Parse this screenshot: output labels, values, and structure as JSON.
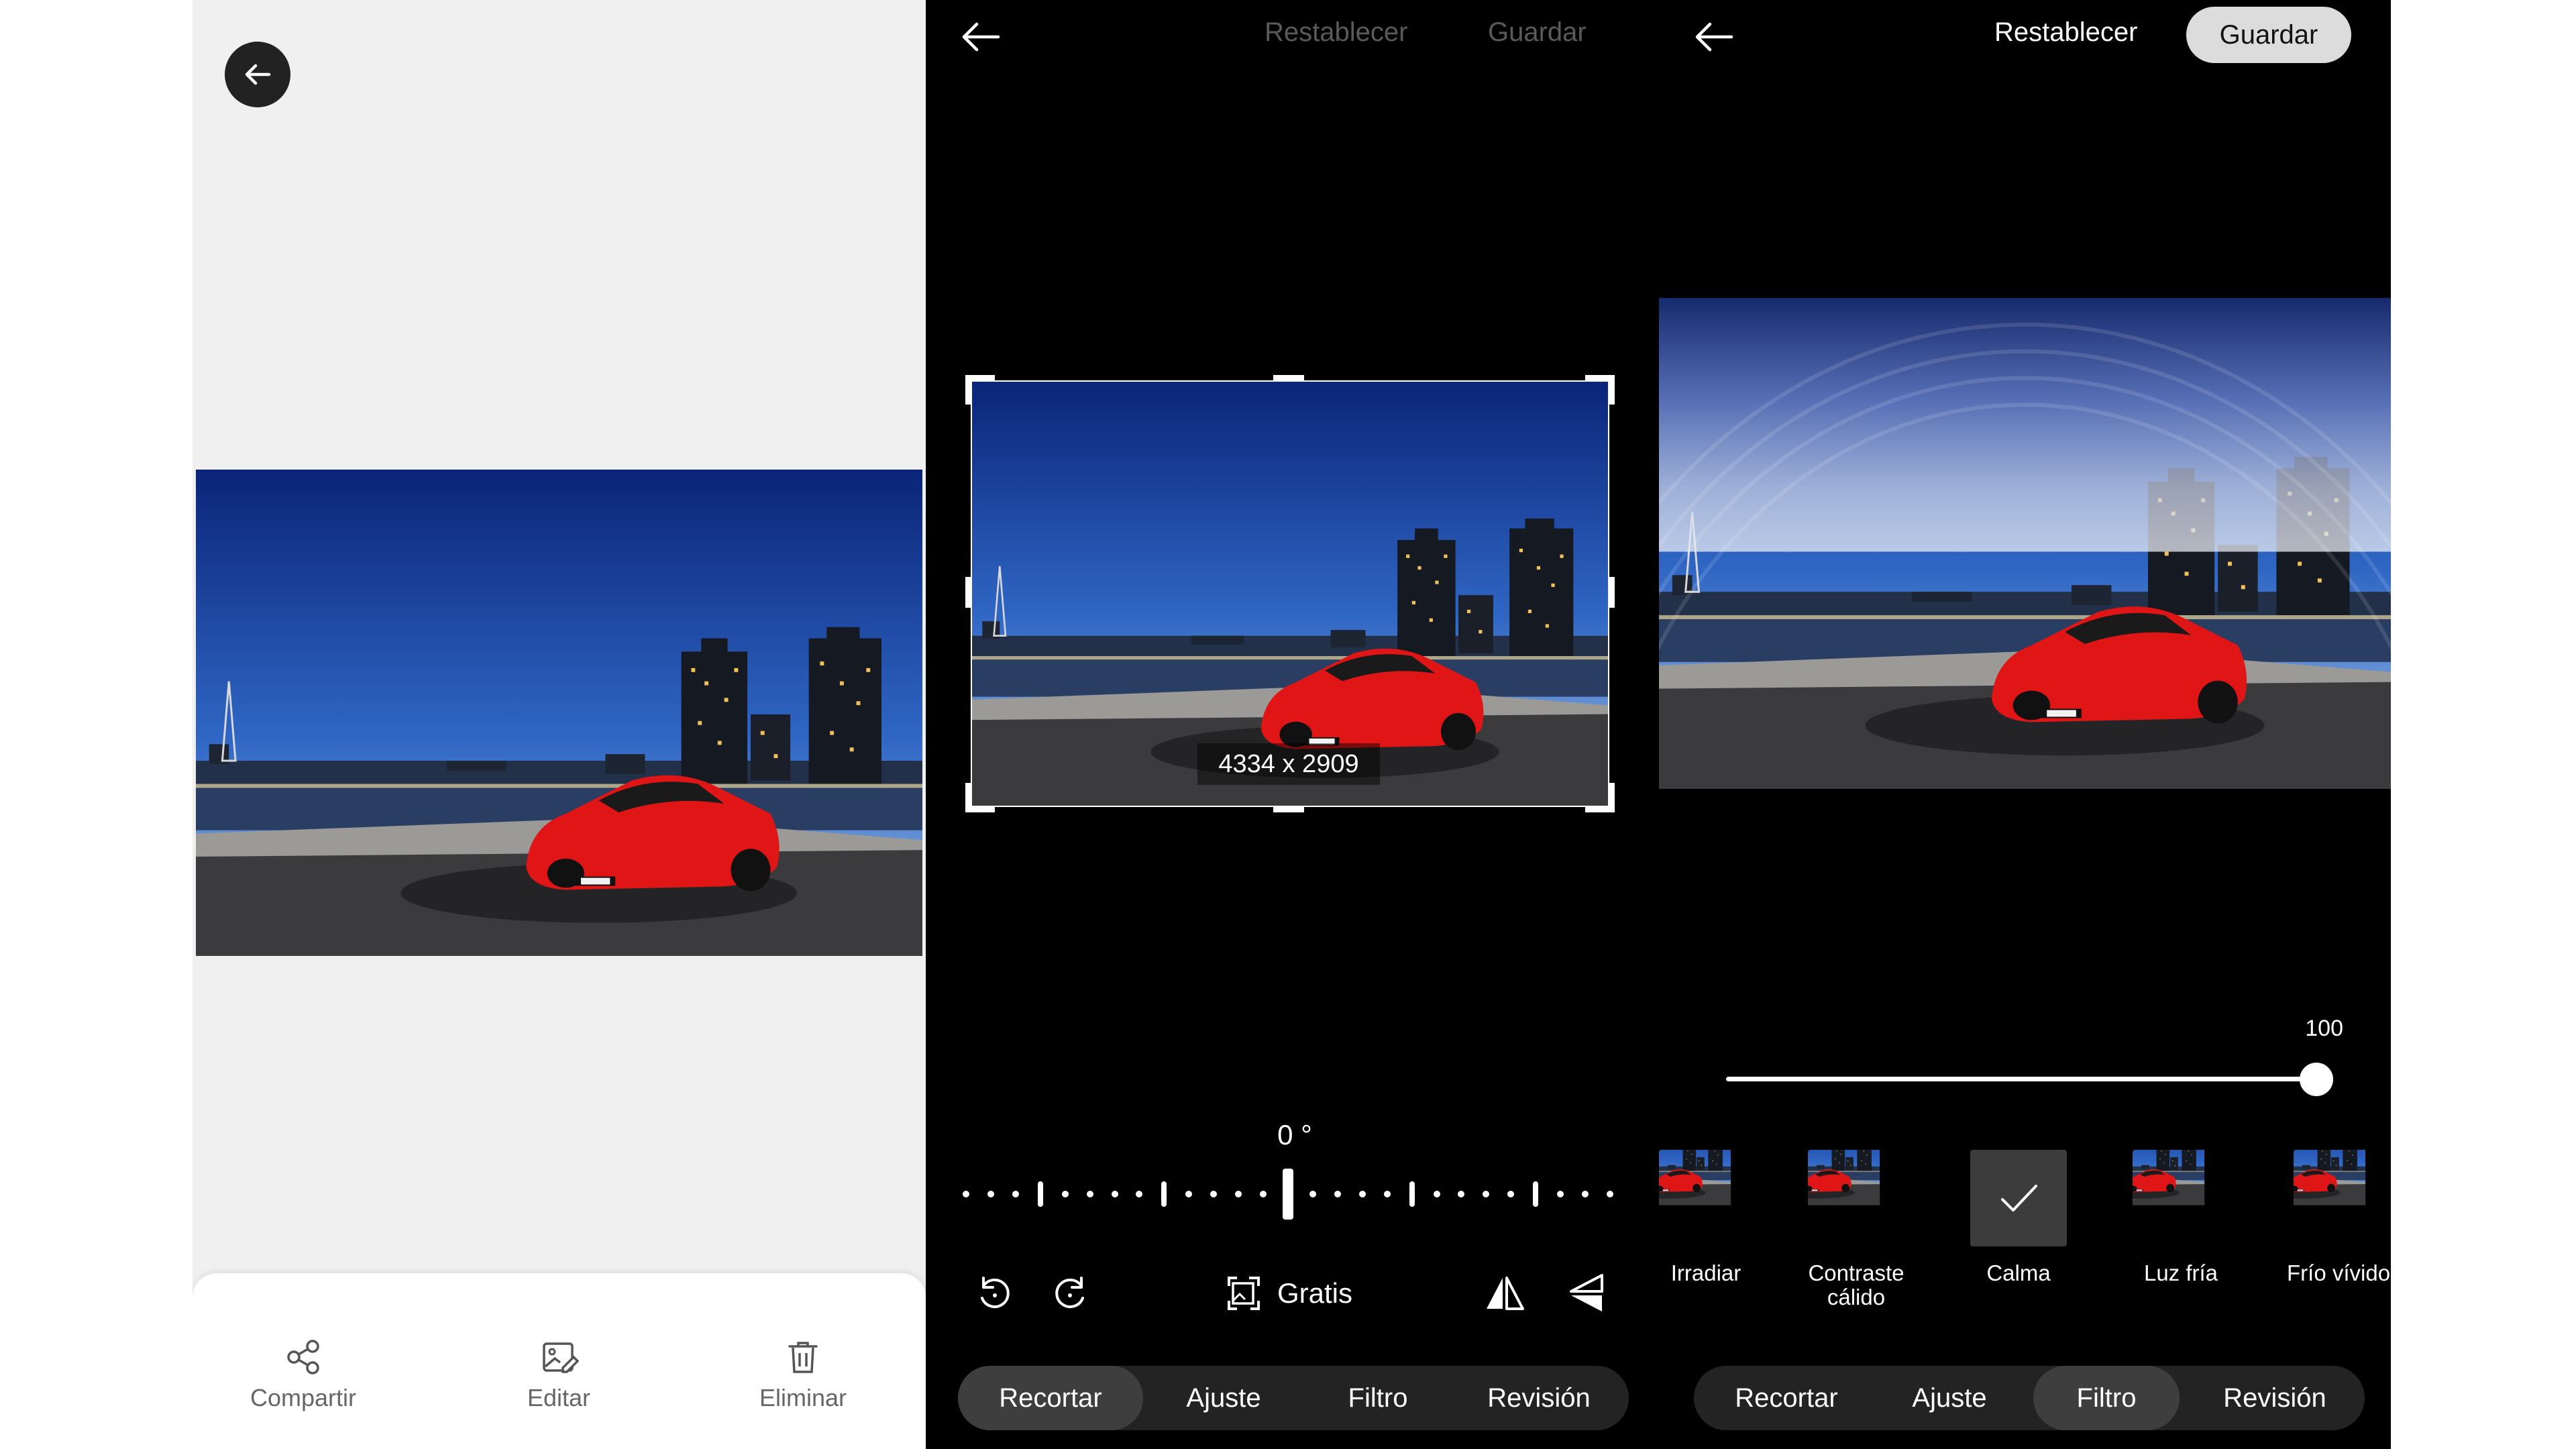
{
  "view": {
    "actions": [
      {
        "label": "Compartir",
        "icon": "share-icon"
      },
      {
        "label": "Editar",
        "icon": "edit-image-icon"
      },
      {
        "label": "Eliminar",
        "icon": "trash-icon"
      }
    ]
  },
  "crop": {
    "reset_label": "Restablecer",
    "save_label": "Guardar",
    "dimensions": "4334 x 2909",
    "angle": "0 °",
    "aspect_label": "Gratis",
    "tabs": [
      "Recortar",
      "Ajuste",
      "Filtro",
      "Revisión"
    ],
    "active_tab": "Recortar"
  },
  "filter": {
    "reset_label": "Restablecer",
    "save_label": "Guardar",
    "intensity_label": "100",
    "intensity": 100,
    "filters": [
      "Irradiar",
      "Contraste\ncálido",
      "Calma",
      "Luz fría",
      "Frío vívido"
    ],
    "selected_filter": "Calma",
    "tabs": [
      "Recortar",
      "Ajuste",
      "Filtro",
      "Revisión"
    ],
    "active_tab": "Filtro"
  },
  "colors": {
    "car_red": "#e01515",
    "sky_top": "#0b2a80",
    "sky_bottom": "#8fb3df",
    "active_pill": "#3e3e3e",
    "save_pill": "#dcdcdc"
  }
}
